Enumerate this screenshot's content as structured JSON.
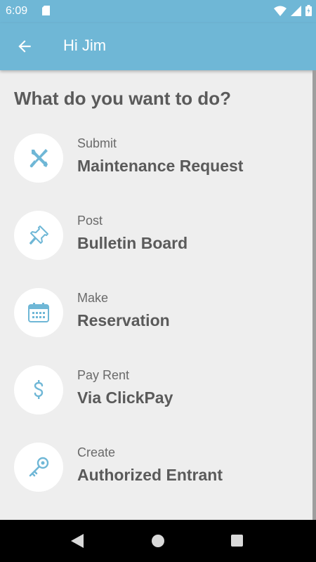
{
  "status_bar": {
    "time": "6:09",
    "icons": [
      "sd-card-icon",
      "wifi-icon",
      "signal-icon",
      "battery-icon"
    ]
  },
  "app_bar": {
    "title": "Hi Jim",
    "back_icon": "arrow-left-icon"
  },
  "main": {
    "heading": "What do you want to do?",
    "items": [
      {
        "sub": "Submit",
        "main": "Maintenance Request",
        "icon": "tools-icon"
      },
      {
        "sub": "Post",
        "main": "Bulletin Board",
        "icon": "pushpin-icon"
      },
      {
        "sub": "Make",
        "main": "Reservation",
        "icon": "calendar-icon"
      },
      {
        "sub": "Pay Rent",
        "main": "Via ClickPay",
        "icon": "dollar-icon"
      },
      {
        "sub": "Create",
        "main": "Authorized Entrant",
        "icon": "key-icon"
      }
    ]
  },
  "colors": {
    "accent": "#6fb7d6",
    "background": "#eeeeee",
    "text": "#5a5a5a"
  },
  "nav_bar": {
    "icons": [
      "nav-back-icon",
      "nav-home-icon",
      "nav-recent-icon"
    ]
  }
}
